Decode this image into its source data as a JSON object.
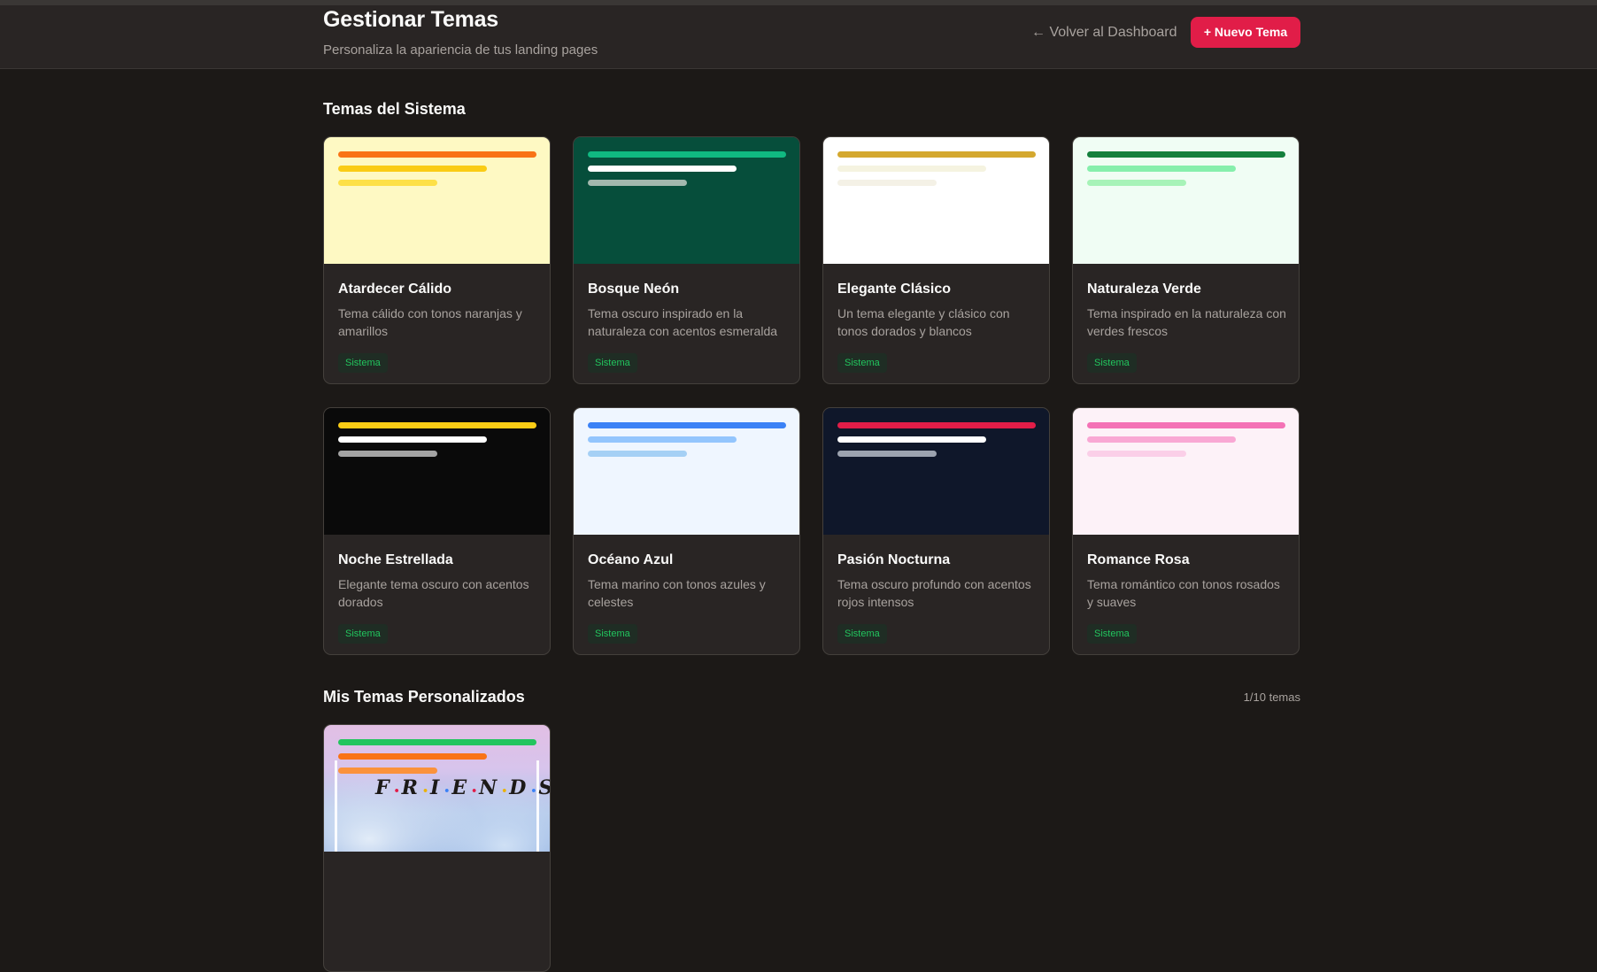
{
  "header": {
    "title": "Gestionar Temas",
    "subtitle": "Personaliza la apariencia de tus landing pages",
    "back_label": "← Volver al Dashboard",
    "new_label": "+ Nuevo Tema"
  },
  "system_section": {
    "title": "Temas del Sistema",
    "themes": [
      {
        "name": "Atardecer Cálido",
        "description": "Tema cálido con tonos naranjas y amarillos",
        "badge": "Sistema",
        "bg": "#fef9c3",
        "bars": [
          "#f97316",
          "#facc15",
          "#fde047"
        ]
      },
      {
        "name": "Bosque Neón",
        "description": "Tema oscuro inspirado en la naturaleza con acentos esmeralda",
        "badge": "Sistema",
        "bg": "#064e3b",
        "bars": [
          "#10b981",
          "#ffffff",
          "#a3b8ae"
        ]
      },
      {
        "name": "Elegante Clásico",
        "description": "Un tema elegante y clásico con tonos dorados y blancos",
        "badge": "Sistema",
        "bg": "#ffffff",
        "bars": [
          "#d4a82f",
          "#f5f3e0",
          "#f4f1e6"
        ]
      },
      {
        "name": "Naturaleza Verde",
        "description": "Tema inspirado en la naturaleza con verdes frescos",
        "badge": "Sistema",
        "bg": "#f0fdf4",
        "bars": [
          "#15803d",
          "#86efac",
          "#a7f3b8"
        ]
      },
      {
        "name": "Noche Estrellada",
        "description": "Elegante tema oscuro con acentos dorados",
        "badge": "Sistema",
        "bg": "#0a0a0a",
        "bars": [
          "#facc15",
          "#ffffff",
          "#a3a3a3"
        ]
      },
      {
        "name": "Océano Azul",
        "description": "Tema marino con tonos azules y celestes",
        "badge": "Sistema",
        "bg": "#eff6ff",
        "bars": [
          "#3b82f6",
          "#93c5fd",
          "#a5d0f5"
        ]
      },
      {
        "name": "Pasión Nocturna",
        "description": "Tema oscuro profundo con acentos rojos intensos",
        "badge": "Sistema",
        "bg": "#0f172a",
        "bars": [
          "#e11d48",
          "#ffffff",
          "#9ca3af"
        ]
      },
      {
        "name": "Romance Rosa",
        "description": "Tema romántico con tonos rosados y suaves",
        "badge": "Sistema",
        "bg": "#fdf2f8",
        "bars": [
          "#f472b6",
          "#f9a8d4",
          "#fbcfe8"
        ]
      }
    ]
  },
  "custom_section": {
    "title": "Mis Temas Personalizados",
    "count": "1/10 temas",
    "themes": [
      {
        "logo": "FRIENDS",
        "bars": [
          "#22c55e",
          "#f97316",
          "#fb923c"
        ]
      }
    ]
  }
}
